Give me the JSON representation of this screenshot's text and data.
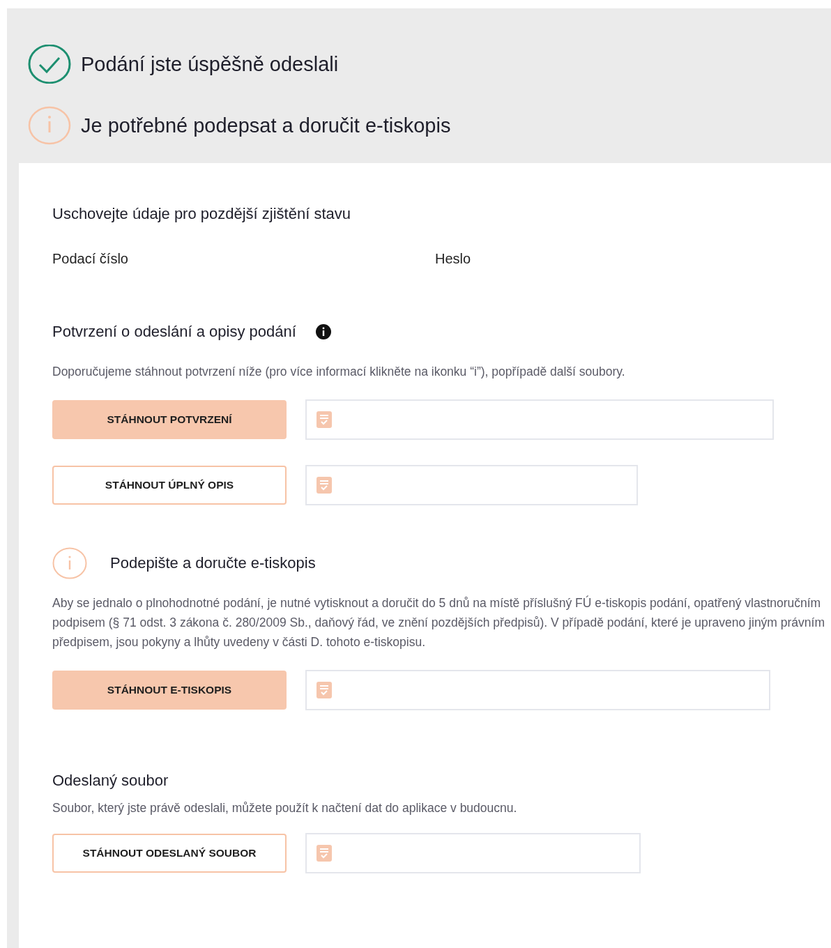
{
  "status": [
    {
      "kind": "success",
      "text": "Podání jste úspěšně odeslali"
    },
    {
      "kind": "warning",
      "text": "Je potřebné podepsat a doručit e-tiskopis"
    }
  ],
  "storage": {
    "title": "Uschovejte údaje pro pozdější zjištění stavu",
    "fields": [
      {
        "label": "Podací číslo"
      },
      {
        "label": "Heslo"
      }
    ]
  },
  "confirmation": {
    "title": "Potvrzení o odeslání a opisy podání",
    "description": "Doporučujeme stáhnout potvrzení níže (pro více informací klikněte na ikonku “i”), popřípadě další soubory.",
    "downloads": [
      {
        "label": "STÁHNOUT POTVRZENÍ",
        "kind": "primary"
      },
      {
        "label": "STÁHNOUT ÚPLNÝ OPIS",
        "kind": "outline"
      }
    ]
  },
  "sign": {
    "title": "Podepište a doručte e-tiskopis",
    "description": "Aby se jednalo o plnohodnotné podání, je nutné vytisknout a doručit do 5 dnů na místě příslušný FÚ e-tiskopis podání, opatřený vlastnoručním podpisem (§ 71 odst. 3 zákona č. 280/2009 Sb., daňový řád, ve znění pozdějších předpisů). V případě podání, které je upraveno jiným právním předpisem, jsou pokyny a lhůty uvedeny v části D. tohoto e-tiskopisu.",
    "downloads": [
      {
        "label": "STÁHNOUT E-TISKOPIS",
        "kind": "primary"
      }
    ]
  },
  "sent_file": {
    "title": "Odeslaný soubor",
    "description": "Soubor, který jste právě odeslali, můžete použít k načtení dat do aplikace v budoucnu.",
    "downloads": [
      {
        "label": "STÁHNOUT ODESLANÝ SOUBOR",
        "kind": "outline"
      }
    ]
  }
}
